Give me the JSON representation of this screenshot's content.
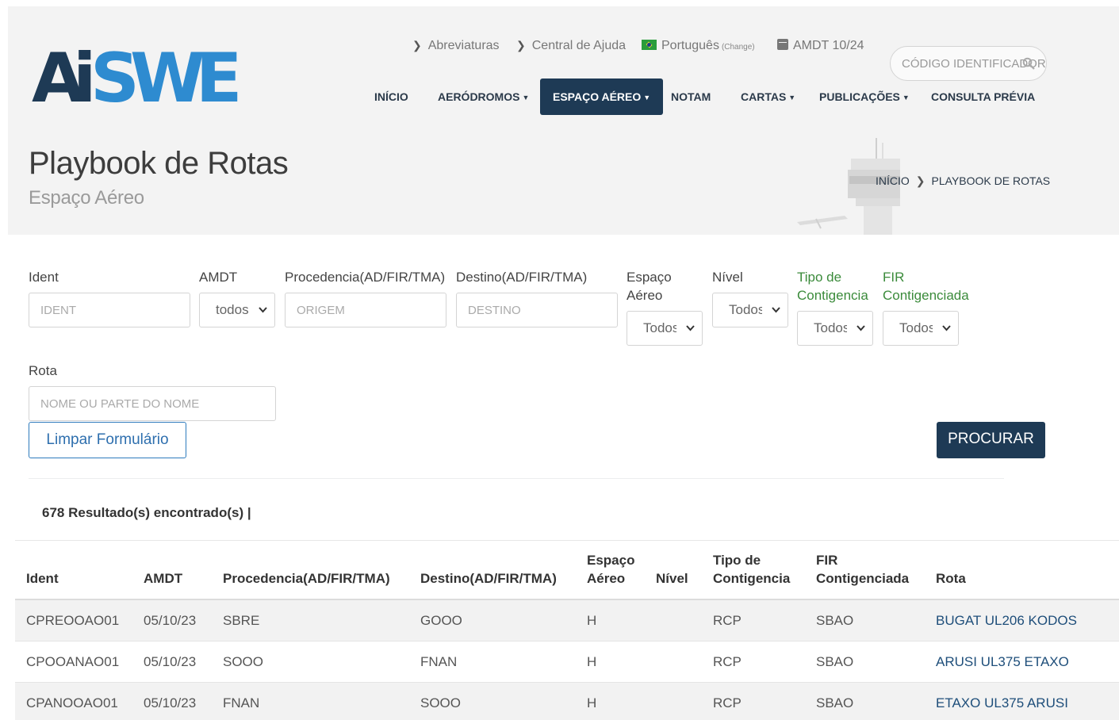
{
  "brand": {
    "logo_text": "AISWEB",
    "primary": "#1e3a55",
    "accent": "#2e8bd0",
    "link_color": "#1e4e7a",
    "green_label": "#3b8b3b"
  },
  "topbar": {
    "abbrev": "Abreviaturas",
    "help": "Central de Ajuda",
    "language": "Português",
    "language_change": "(Change)",
    "amdt": "AMDT 10/24",
    "ident_placeholder": "CÓDIGO IDENTIFICADOR"
  },
  "nav": {
    "inicio": "INÍCIO",
    "aerodromos": "AERÓDROMOS",
    "espaco_aereo": "ESPAÇO AÉREO",
    "notam": "NOTAM",
    "cartas": "CARTAS",
    "publicacoes": "PUBLICAÇÕES",
    "consulta": "CONSULTA PRÉVIA"
  },
  "page": {
    "title": "Playbook de Rotas",
    "subtitle": "Espaço Aéreo",
    "breadcrumb_home": "INÍCIO",
    "breadcrumb_current": "PLAYBOOK DE ROTAS"
  },
  "form": {
    "ident_label": "Ident",
    "ident_placeholder": "IDENT",
    "amdt_label": "AMDT",
    "amdt_value": "todos",
    "origem_label": "Procedencia(AD/FIR/TMA)",
    "origem_placeholder": "ORIGEM",
    "destino_label": "Destino(AD/FIR/TMA)",
    "destino_placeholder": "DESTINO",
    "espaco_label_1": "Espaço",
    "espaco_label_2": "Aéreo",
    "espaco_value": "Todos",
    "nivel_label": "Nível",
    "nivel_value": "Todos",
    "tipo_label_1": "Tipo de",
    "tipo_label_2": "Contigencia",
    "tipo_value": "Todos",
    "fir_label_1": "FIR",
    "fir_label_2": "Contigenciada",
    "fir_value": "Todos",
    "rota_label": "Rota",
    "rota_placeholder": "NOME OU PARTE DO NOME",
    "clear_button": "Limpar Formulário",
    "search_button": "PROCURAR"
  },
  "results": {
    "count_text": "678 Resultado(s) encontrado(s) |"
  },
  "table": {
    "headers": {
      "ident": "Ident",
      "amdt": "AMDT",
      "procedencia": "Procedencia(AD/FIR/TMA)",
      "destino": "Destino(AD/FIR/TMA)",
      "espaco_1": "Espaço",
      "espaco_2": "Aéreo",
      "nivel": "Nível",
      "tipo_1": "Tipo de",
      "tipo_2": "Contigencia",
      "fir_1": "FIR",
      "fir_2": "Contigenciada",
      "rota": "Rota"
    },
    "rows": [
      {
        "ident": "CPREOOAO01",
        "amdt": "05/10/23",
        "procedencia": "SBRE",
        "destino": "GOOO",
        "espaco": "H",
        "nivel": "",
        "tipo": "RCP",
        "fir": "SBAO",
        "rota": "BUGAT UL206 KODOS"
      },
      {
        "ident": "CPOOANAO01",
        "amdt": "05/10/23",
        "procedencia": "SOOO",
        "destino": "FNAN",
        "espaco": "H",
        "nivel": "",
        "tipo": "RCP",
        "fir": "SBAO",
        "rota": "ARUSI UL375 ETAXO"
      },
      {
        "ident": "CPANOOAO01",
        "amdt": "05/10/23",
        "procedencia": "FNAN",
        "destino": "SOOO",
        "espaco": "H",
        "nivel": "",
        "tipo": "RCP",
        "fir": "SBAO",
        "rota": "ETAXO UL375 ARUSI"
      }
    ]
  }
}
